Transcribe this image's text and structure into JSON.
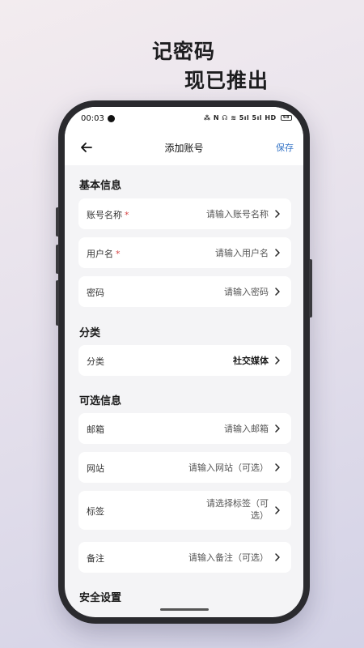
{
  "promo": {
    "line1": "记密码",
    "line2": "现已推出"
  },
  "status_bar": {
    "time": "00:03",
    "icons_text": "⁂ N ☊ ≋ 5ıl 5ıl HD",
    "battery": "68"
  },
  "nav": {
    "title": "添加账号",
    "save_label": "保存",
    "back_icon": "arrow-left-icon"
  },
  "sections": {
    "basic": {
      "title": "基本信息",
      "account_name": {
        "label": "账号名称",
        "required": "*",
        "placeholder": "请输入账号名称"
      },
      "username": {
        "label": "用户名",
        "required": "*",
        "placeholder": "请输入用户名"
      },
      "password": {
        "label": "密码",
        "placeholder": "请输入密码"
      }
    },
    "category": {
      "title": "分类",
      "category": {
        "label": "分类",
        "value": "社交媒体"
      }
    },
    "optional": {
      "title": "可选信息",
      "email": {
        "label": "邮箱",
        "placeholder": "请输入邮箱"
      },
      "website": {
        "label": "网站",
        "placeholder": "请输入网站（可选）"
      },
      "tags": {
        "label": "标签",
        "placeholder": "请选择标签（可选）"
      },
      "notes": {
        "label": "备注",
        "placeholder": "请输入备注（可选）"
      }
    },
    "security": {
      "title": "安全设置"
    }
  },
  "icons": {
    "chevron": "chevron-right-icon"
  }
}
